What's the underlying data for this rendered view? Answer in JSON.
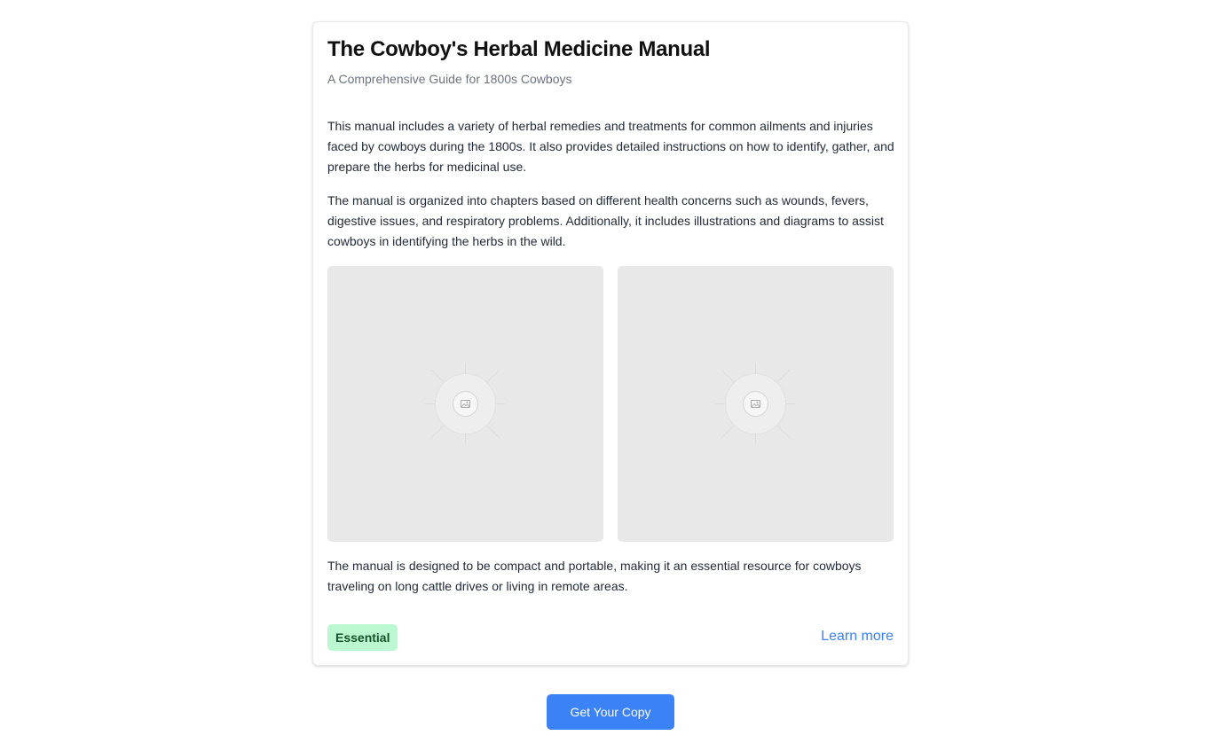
{
  "card": {
    "title": "The Cowboy's Herbal Medicine Manual",
    "subtitle": "A Comprehensive Guide for 1800s Cowboys",
    "paragraphs": [
      "This manual includes a variety of herbal remedies and treatments for common ailments and injuries faced by cowboys during the 1800s. It also provides detailed instructions on how to identify, gather, and prepare the herbs for medicinal use.",
      "The manual is organized into chapters based on different health concerns such as wounds, fevers, digestive issues, and respiratory problems. Additionally, it includes illustrations and diagrams to assist cowboys in identifying the herbs in the wild.",
      "The manual is designed to be compact and portable, making it an essential resource for cowboys traveling on long cattle drives or living in remote areas."
    ],
    "images": [
      {
        "icon": "image-placeholder-icon"
      },
      {
        "icon": "image-placeholder-icon"
      }
    ],
    "badge": "Essential",
    "learn_more": "Learn more"
  },
  "cta": {
    "label": "Get Your Copy"
  },
  "colors": {
    "accent": "#3b82f6",
    "badge_bg": "#bbf7d0",
    "badge_text": "#14532d",
    "placeholder_bg": "#e8e8e8"
  }
}
